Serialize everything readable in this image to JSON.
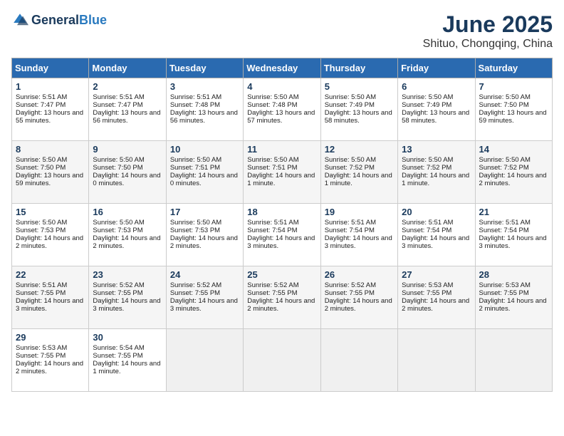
{
  "header": {
    "logo_general": "General",
    "logo_blue": "Blue",
    "month_year": "June 2025",
    "location": "Shituo, Chongqing, China"
  },
  "weekdays": [
    "Sunday",
    "Monday",
    "Tuesday",
    "Wednesday",
    "Thursday",
    "Friday",
    "Saturday"
  ],
  "weeks": [
    [
      {
        "day": "1",
        "sunrise": "Sunrise: 5:51 AM",
        "sunset": "Sunset: 7:47 PM",
        "daylight": "Daylight: 13 hours and 55 minutes."
      },
      {
        "day": "2",
        "sunrise": "Sunrise: 5:51 AM",
        "sunset": "Sunset: 7:47 PM",
        "daylight": "Daylight: 13 hours and 56 minutes."
      },
      {
        "day": "3",
        "sunrise": "Sunrise: 5:51 AM",
        "sunset": "Sunset: 7:48 PM",
        "daylight": "Daylight: 13 hours and 56 minutes."
      },
      {
        "day": "4",
        "sunrise": "Sunrise: 5:50 AM",
        "sunset": "Sunset: 7:48 PM",
        "daylight": "Daylight: 13 hours and 57 minutes."
      },
      {
        "day": "5",
        "sunrise": "Sunrise: 5:50 AM",
        "sunset": "Sunset: 7:49 PM",
        "daylight": "Daylight: 13 hours and 58 minutes."
      },
      {
        "day": "6",
        "sunrise": "Sunrise: 5:50 AM",
        "sunset": "Sunset: 7:49 PM",
        "daylight": "Daylight: 13 hours and 58 minutes."
      },
      {
        "day": "7",
        "sunrise": "Sunrise: 5:50 AM",
        "sunset": "Sunset: 7:50 PM",
        "daylight": "Daylight: 13 hours and 59 minutes."
      }
    ],
    [
      {
        "day": "8",
        "sunrise": "Sunrise: 5:50 AM",
        "sunset": "Sunset: 7:50 PM",
        "daylight": "Daylight: 13 hours and 59 minutes."
      },
      {
        "day": "9",
        "sunrise": "Sunrise: 5:50 AM",
        "sunset": "Sunset: 7:50 PM",
        "daylight": "Daylight: 14 hours and 0 minutes."
      },
      {
        "day": "10",
        "sunrise": "Sunrise: 5:50 AM",
        "sunset": "Sunset: 7:51 PM",
        "daylight": "Daylight: 14 hours and 0 minutes."
      },
      {
        "day": "11",
        "sunrise": "Sunrise: 5:50 AM",
        "sunset": "Sunset: 7:51 PM",
        "daylight": "Daylight: 14 hours and 1 minute."
      },
      {
        "day": "12",
        "sunrise": "Sunrise: 5:50 AM",
        "sunset": "Sunset: 7:52 PM",
        "daylight": "Daylight: 14 hours and 1 minute."
      },
      {
        "day": "13",
        "sunrise": "Sunrise: 5:50 AM",
        "sunset": "Sunset: 7:52 PM",
        "daylight": "Daylight: 14 hours and 1 minute."
      },
      {
        "day": "14",
        "sunrise": "Sunrise: 5:50 AM",
        "sunset": "Sunset: 7:52 PM",
        "daylight": "Daylight: 14 hours and 2 minutes."
      }
    ],
    [
      {
        "day": "15",
        "sunrise": "Sunrise: 5:50 AM",
        "sunset": "Sunset: 7:53 PM",
        "daylight": "Daylight: 14 hours and 2 minutes."
      },
      {
        "day": "16",
        "sunrise": "Sunrise: 5:50 AM",
        "sunset": "Sunset: 7:53 PM",
        "daylight": "Daylight: 14 hours and 2 minutes."
      },
      {
        "day": "17",
        "sunrise": "Sunrise: 5:50 AM",
        "sunset": "Sunset: 7:53 PM",
        "daylight": "Daylight: 14 hours and 2 minutes."
      },
      {
        "day": "18",
        "sunrise": "Sunrise: 5:51 AM",
        "sunset": "Sunset: 7:54 PM",
        "daylight": "Daylight: 14 hours and 3 minutes."
      },
      {
        "day": "19",
        "sunrise": "Sunrise: 5:51 AM",
        "sunset": "Sunset: 7:54 PM",
        "daylight": "Daylight: 14 hours and 3 minutes."
      },
      {
        "day": "20",
        "sunrise": "Sunrise: 5:51 AM",
        "sunset": "Sunset: 7:54 PM",
        "daylight": "Daylight: 14 hours and 3 minutes."
      },
      {
        "day": "21",
        "sunrise": "Sunrise: 5:51 AM",
        "sunset": "Sunset: 7:54 PM",
        "daylight": "Daylight: 14 hours and 3 minutes."
      }
    ],
    [
      {
        "day": "22",
        "sunrise": "Sunrise: 5:51 AM",
        "sunset": "Sunset: 7:55 PM",
        "daylight": "Daylight: 14 hours and 3 minutes."
      },
      {
        "day": "23",
        "sunrise": "Sunrise: 5:52 AM",
        "sunset": "Sunset: 7:55 PM",
        "daylight": "Daylight: 14 hours and 3 minutes."
      },
      {
        "day": "24",
        "sunrise": "Sunrise: 5:52 AM",
        "sunset": "Sunset: 7:55 PM",
        "daylight": "Daylight: 14 hours and 3 minutes."
      },
      {
        "day": "25",
        "sunrise": "Sunrise: 5:52 AM",
        "sunset": "Sunset: 7:55 PM",
        "daylight": "Daylight: 14 hours and 2 minutes."
      },
      {
        "day": "26",
        "sunrise": "Sunrise: 5:52 AM",
        "sunset": "Sunset: 7:55 PM",
        "daylight": "Daylight: 14 hours and 2 minutes."
      },
      {
        "day": "27",
        "sunrise": "Sunrise: 5:53 AM",
        "sunset": "Sunset: 7:55 PM",
        "daylight": "Daylight: 14 hours and 2 minutes."
      },
      {
        "day": "28",
        "sunrise": "Sunrise: 5:53 AM",
        "sunset": "Sunset: 7:55 PM",
        "daylight": "Daylight: 14 hours and 2 minutes."
      }
    ],
    [
      {
        "day": "29",
        "sunrise": "Sunrise: 5:53 AM",
        "sunset": "Sunset: 7:55 PM",
        "daylight": "Daylight: 14 hours and 2 minutes."
      },
      {
        "day": "30",
        "sunrise": "Sunrise: 5:54 AM",
        "sunset": "Sunset: 7:55 PM",
        "daylight": "Daylight: 14 hours and 1 minute."
      },
      null,
      null,
      null,
      null,
      null
    ]
  ]
}
